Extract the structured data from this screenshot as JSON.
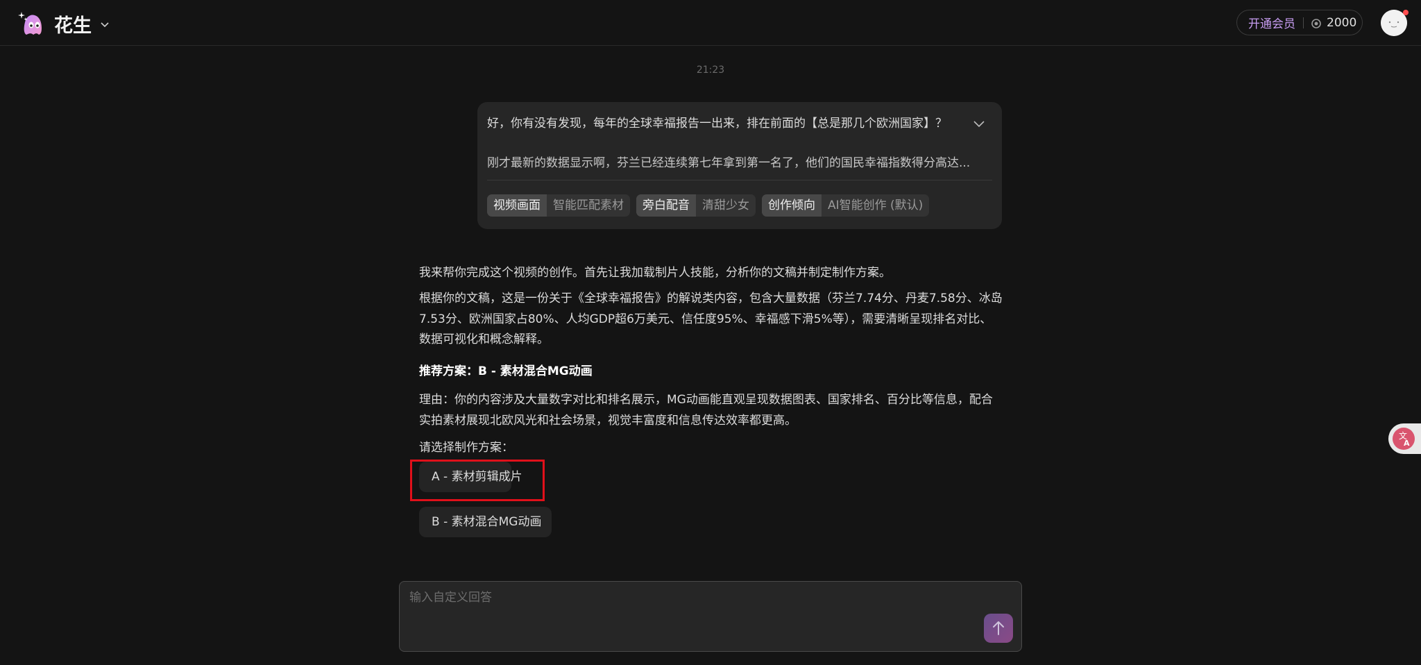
{
  "header": {
    "brand_name": "花生",
    "vip_label": "开通会员",
    "credits": "2000",
    "icons": [
      "ghost-logo-icon",
      "chevron-down-icon",
      "coin-icon",
      "avatar"
    ]
  },
  "chat": {
    "timestamp": "21:23",
    "user_message": {
      "line1": "好，你有没有发现，每年的全球幸福报告一出来，排在前面的【总是那几个欧洲国家】？",
      "line2": "刚才最新的数据显示啊，芬兰已经连续第七年拿到第一名了，他们的国民幸福指数得分高达...",
      "tags": [
        {
          "key": "视频画面",
          "value": "智能匹配素材"
        },
        {
          "key": "旁白配音",
          "value": "清甜少女"
        },
        {
          "key": "创作倾向",
          "value": "AI智能创作 (默认)"
        }
      ]
    },
    "assistant": {
      "p1": "我来帮你完成这个视频的创作。首先让我加载制片人技能，分析你的文稿并制定制作方案。",
      "p2": "根据你的文稿，这是一份关于《全球幸福报告》的解说类内容，包含大量数据（芬兰7.74分、丹麦7.58分、冰岛7.53分、欧洲国家占80%、人均GDP超6万美元、信任度95%、幸福感下滑5%等），需要清晰呈现排名对比、数据可视化和概念解释。",
      "recommend": "推荐方案：B - 素材混合MG动画",
      "reason": "理由：你的内容涉及大量数字对比和排名展示，MG动画能直观呈现数据图表、国家排名、百分比等信息，配合实拍素材展现北欧风光和社会场景，视觉丰富度和信息传达效率都更高。",
      "prompt": "请选择制作方案：",
      "options": [
        "A - 素材剪辑成片",
        "B - 素材混合MG动画"
      ]
    }
  },
  "composer": {
    "placeholder": "输入自定义回答"
  },
  "colors": {
    "background": "#141414",
    "vip_accent": "#c69cf0",
    "highlight": "#e0101a",
    "send_button": "#7a4c8a"
  }
}
